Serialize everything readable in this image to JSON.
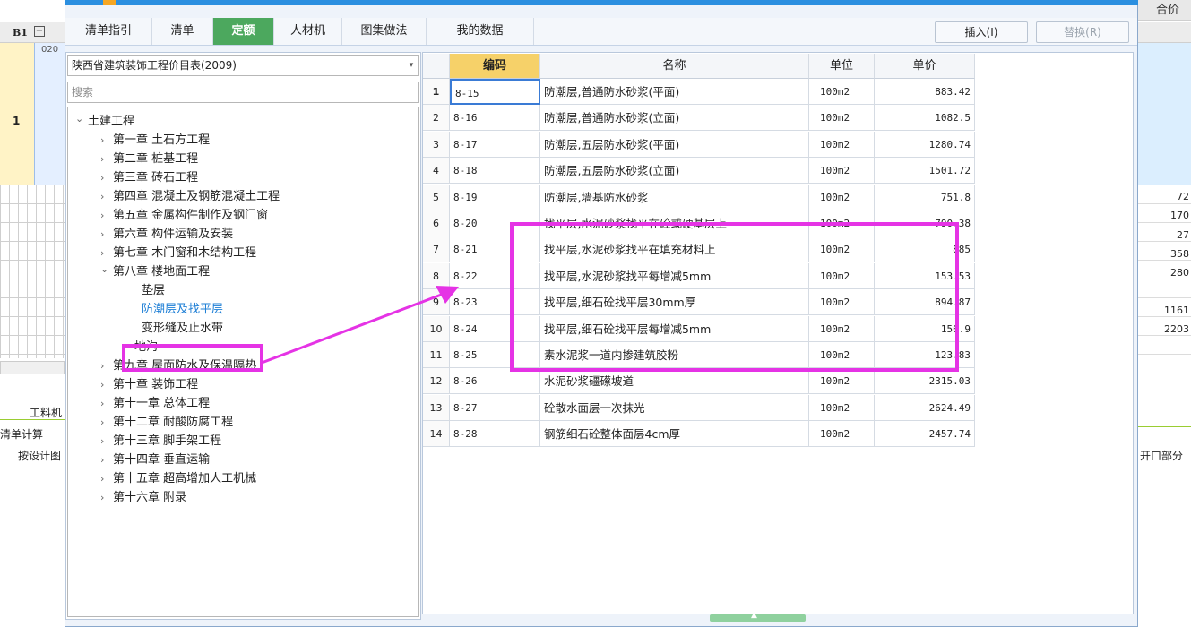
{
  "background": {
    "top_right_header": "合价",
    "row_label": "B1",
    "collapse_glyph": "−",
    "row_code_fragment": "020",
    "row_number": "1",
    "right_values": [
      "72",
      "170",
      "27",
      "358",
      "280",
      "",
      "1161",
      "2203"
    ],
    "bottom_tab": "工料机",
    "calc_label": "清单计算",
    "note_left": "按设计图",
    "note_right": "开口部分"
  },
  "dialog": {
    "tabs": [
      {
        "label": "清单指引",
        "active": false
      },
      {
        "label": "清单",
        "active": false
      },
      {
        "label": "定额",
        "active": true
      },
      {
        "label": "人材机",
        "active": false
      },
      {
        "label": "图集做法",
        "active": false
      },
      {
        "label": "我的数据",
        "active": false
      }
    ],
    "insert_button": "插入(I)",
    "replace_button": "替换(R)",
    "library_selected": "陕西省建筑装饰工程价目表(2009)",
    "search_placeholder": "搜索",
    "tree": [
      {
        "label": "土建工程",
        "level": 0,
        "expanded": true
      },
      {
        "label": "第一章 土石方工程",
        "level": 1,
        "expanded": false
      },
      {
        "label": "第二章 桩基工程",
        "level": 1,
        "expanded": false
      },
      {
        "label": "第三章 砖石工程",
        "level": 1,
        "expanded": false
      },
      {
        "label": "第四章 混凝土及钢筋混凝土工程",
        "level": 1,
        "expanded": false
      },
      {
        "label": "第五章 金属构件制作及钢门窗",
        "level": 1,
        "expanded": false
      },
      {
        "label": "第六章 构件运输及安装",
        "level": 1,
        "expanded": false
      },
      {
        "label": "第七章 木门窗和木结构工程",
        "level": 1,
        "expanded": false
      },
      {
        "label": "第八章 楼地面工程",
        "level": 1,
        "expanded": true
      },
      {
        "label": "垫层",
        "level": 2,
        "leaf": true
      },
      {
        "label": "防潮层及找平层",
        "level": 2,
        "leaf": true,
        "selected": true
      },
      {
        "label": "变形缝及止水带",
        "level": 2,
        "leaf": true
      },
      {
        "label": "地沟",
        "level": 2,
        "expanded": false
      },
      {
        "label": "第九章 屋面防水及保温隔热",
        "level": 1,
        "expanded": false
      },
      {
        "label": "第十章 装饰工程",
        "level": 1,
        "expanded": false
      },
      {
        "label": "第十一章 总体工程",
        "level": 1,
        "expanded": false
      },
      {
        "label": "第十二章 耐酸防腐工程",
        "level": 1,
        "expanded": false
      },
      {
        "label": "第十三章 脚手架工程",
        "level": 1,
        "expanded": false
      },
      {
        "label": "第十四章 垂直运输",
        "level": 1,
        "expanded": false
      },
      {
        "label": "第十五章 超高增加人工机械",
        "level": 1,
        "expanded": false
      },
      {
        "label": "第十六章 附录",
        "level": 1,
        "expanded": false
      }
    ],
    "table": {
      "headers": {
        "code": "编码",
        "name": "名称",
        "unit": "单位",
        "price": "单价"
      },
      "rows": [
        {
          "idx": "1",
          "code": "8-15",
          "name": "防潮层,普通防水砂浆(平面)",
          "unit": "100m2",
          "price": "883.42"
        },
        {
          "idx": "2",
          "code": "8-16",
          "name": "防潮层,普通防水砂浆(立面)",
          "unit": "100m2",
          "price": "1082.5"
        },
        {
          "idx": "3",
          "code": "8-17",
          "name": "防潮层,五层防水砂浆(平面)",
          "unit": "100m2",
          "price": "1280.74"
        },
        {
          "idx": "4",
          "code": "8-18",
          "name": "防潮层,五层防水砂浆(立面)",
          "unit": "100m2",
          "price": "1501.72"
        },
        {
          "idx": "5",
          "code": "8-19",
          "name": "防潮层,墙基防水砂浆",
          "unit": "100m2",
          "price": "751.8"
        },
        {
          "idx": "6",
          "code": "8-20",
          "name": "找平层,水泥砂浆找平在砼或硬基层上",
          "unit": "100m2",
          "price": "790.38"
        },
        {
          "idx": "7",
          "code": "8-21",
          "name": "找平层,水泥砂浆找平在填充材料上",
          "unit": "100m2",
          "price": "885"
        },
        {
          "idx": "8",
          "code": "8-22",
          "name": "找平层,水泥砂浆找平每增减5mm",
          "unit": "100m2",
          "price": "153.53"
        },
        {
          "idx": "9",
          "code": "8-23",
          "name": "找平层,细石砼找平层30mm厚",
          "unit": "100m2",
          "price": "894.87"
        },
        {
          "idx": "10",
          "code": "8-24",
          "name": "找平层,细石砼找平层每增减5mm",
          "unit": "100m2",
          "price": "156.9"
        },
        {
          "idx": "11",
          "code": "8-25",
          "name": "素水泥浆一道内掺建筑胶粉",
          "unit": "100m2",
          "price": "123.83"
        },
        {
          "idx": "12",
          "code": "8-26",
          "name": "水泥砂浆礓礤坡道",
          "unit": "100m2",
          "price": "2315.03"
        },
        {
          "idx": "13",
          "code": "8-27",
          "name": "砼散水面层一次抹光",
          "unit": "100m2",
          "price": "2624.49"
        },
        {
          "idx": "14",
          "code": "8-28",
          "name": "钢筋细石砼整体面层4cm厚",
          "unit": "100m2",
          "price": "2457.74"
        }
      ]
    }
  },
  "colors": {
    "active_tab": "#4ca85e",
    "code_header": "#f6d169",
    "highlight": "#e533e5",
    "selected_tree_text": "#1e7fd6"
  },
  "icons": {
    "expanded": "chevron-down-icon",
    "collapsed": "chevron-right-icon",
    "combo_arrow": "dropdown-arrow-icon"
  }
}
